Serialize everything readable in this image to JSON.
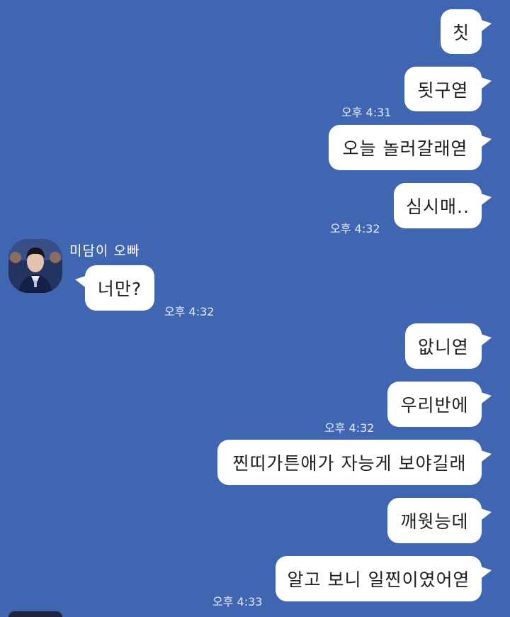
{
  "chat": {
    "messages": [
      {
        "text": "칫"
      },
      {
        "text": "됫구엳"
      },
      {
        "text": "오늘 놀러갈래엳"
      },
      {
        "text": "심시매.."
      },
      {
        "text": "너만?"
      },
      {
        "text": "앖니엳"
      },
      {
        "text": "우리반에"
      },
      {
        "text": "찐띠가튼애가 자능게 보야길래"
      },
      {
        "text": "깨웟능데"
      },
      {
        "text": "알고 보니 일찐이였어엳"
      }
    ],
    "times": [
      "오후 4:31",
      "오후 4:32",
      "오후 4:32",
      "오후 4:32",
      "오후 4:33"
    ],
    "sender_name": "미담이 오빠"
  },
  "colors": {
    "background": "#4066b2",
    "bubble": "#ffffff",
    "timestamp": "#e4ebf7"
  }
}
